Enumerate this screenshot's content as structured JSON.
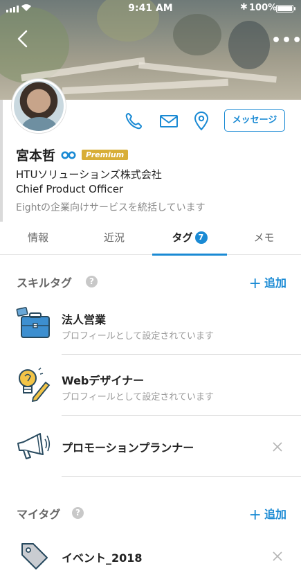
{
  "status_bar": {
    "time": "9:41 AM",
    "bluetooth": "✱",
    "battery": "100%"
  },
  "header": {
    "back_icon": "chevron-left-icon",
    "more_label": "•••"
  },
  "profile": {
    "name": "宮本哲",
    "badge": "Premium",
    "company": "HTUソリューションズ株式会社",
    "title": "Chief Product Officer",
    "bio": "Eightの企業向けサービスを統括しています",
    "message_button": "メッセージ"
  },
  "tabs": [
    {
      "label": "情報"
    },
    {
      "label": "近況"
    },
    {
      "label": "タグ",
      "count": "7"
    },
    {
      "label": "メモ"
    }
  ],
  "skill_tags": {
    "title": "スキルタグ",
    "help": "?",
    "add_label": "追加",
    "add_symbol": "+",
    "items": [
      {
        "name": "法人営業",
        "sub": "プロフィールとして設定されています",
        "icon": "briefcase-icon"
      },
      {
        "name": "Webデザイナー",
        "sub": "プロフィールとして設定されています",
        "icon": "lightbulb-pencil-icon"
      },
      {
        "name": "プロモーションプランナー",
        "icon": "megaphone-icon"
      }
    ]
  },
  "my_tags": {
    "title": "マイタグ",
    "help": "?",
    "add_label": "追加",
    "add_symbol": "+",
    "items": [
      {
        "name": "イベント_2018",
        "icon": "tag-icon"
      }
    ]
  },
  "colors": {
    "accent": "#1a8ad4",
    "premium": "#d8ae37"
  }
}
